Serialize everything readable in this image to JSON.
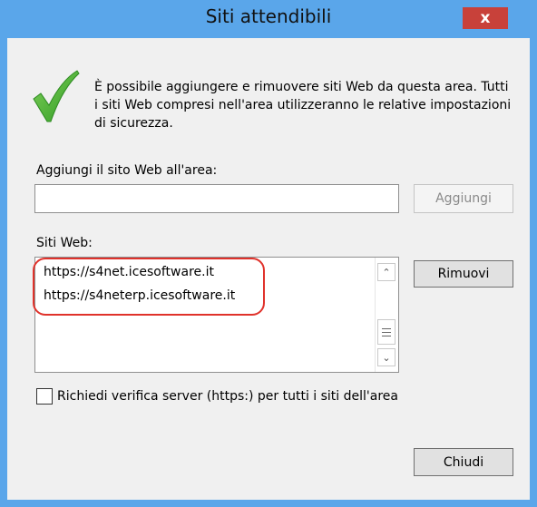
{
  "window": {
    "title": "Siti attendibili",
    "close_label": "x"
  },
  "info": {
    "icon": "checkmark-icon",
    "text": "È possibile aggiungere e rimuovere siti Web da questa area. Tutti i siti Web compresi nell'area utilizzeranno le relative impostazioni di sicurezza."
  },
  "add_site": {
    "label": "Aggiungi il sito Web all'area:",
    "value": "",
    "button": "Aggiungi"
  },
  "websites": {
    "label": "Siti Web:",
    "items": [
      "https://s4net.icesoftware.it",
      "https://s4neterp.icesoftware.it"
    ],
    "remove_button": "Rimuovi"
  },
  "https_check": {
    "label": "Richiedi verifica server (https:) per tutti i siti dell'area",
    "checked": false
  },
  "close_button": "Chiudi",
  "colors": {
    "frame": "#5aa6ea",
    "close": "#c8413a",
    "annotation": "#e0322b",
    "check": "#4caf2e"
  }
}
